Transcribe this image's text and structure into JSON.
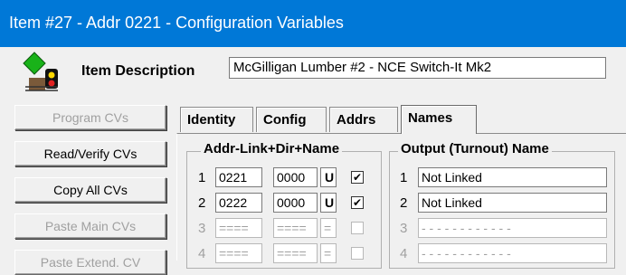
{
  "window": {
    "title": "Item #27 - Addr 0221 - Configuration Variables"
  },
  "header": {
    "label": "Item Description",
    "value": "McGilligan Lumber #2 - NCE Switch-It Mk2"
  },
  "sidebar": {
    "buttons": [
      {
        "label": "Program CVs",
        "enabled": false
      },
      {
        "label": "Read/Verify CVs",
        "enabled": true
      },
      {
        "label": "Copy All CVs",
        "enabled": true
      },
      {
        "label": "Paste Main CVs",
        "enabled": false
      },
      {
        "label": "Paste Extend. CV",
        "enabled": false
      }
    ]
  },
  "tabs": [
    {
      "label": "Identity",
      "active": false
    },
    {
      "label": "Config",
      "active": false
    },
    {
      "label": "Addrs",
      "active": false
    },
    {
      "label": "Names",
      "active": true
    }
  ],
  "addr_group": {
    "title": "Addr-Link+Dir+Name",
    "rows": [
      {
        "num": "1",
        "addr": "0221",
        "link": "0000",
        "dir": "U",
        "checked": true,
        "enabled": true
      },
      {
        "num": "2",
        "addr": "0222",
        "link": "0000",
        "dir": "U",
        "checked": true,
        "enabled": true
      },
      {
        "num": "3",
        "addr": "====",
        "link": "====",
        "dir": "=",
        "checked": false,
        "enabled": false
      },
      {
        "num": "4",
        "addr": "====",
        "link": "====",
        "dir": "=",
        "checked": false,
        "enabled": false
      }
    ]
  },
  "output_group": {
    "title": "Output (Turnout) Name",
    "rows": [
      {
        "num": "1",
        "name": "Not Linked",
        "enabled": true
      },
      {
        "num": "2",
        "name": "Not Linked",
        "enabled": true
      },
      {
        "num": "3",
        "name": "- - - - - - - - - - - -",
        "enabled": false
      },
      {
        "num": "4",
        "name": "- - - - - - - - - - - -",
        "enabled": false
      }
    ]
  },
  "symbols": {
    "check": "✔"
  },
  "colors": {
    "titlebar": "#0078d7",
    "icon_green": "#19b219",
    "disabled_text": "#a0a0a0"
  }
}
